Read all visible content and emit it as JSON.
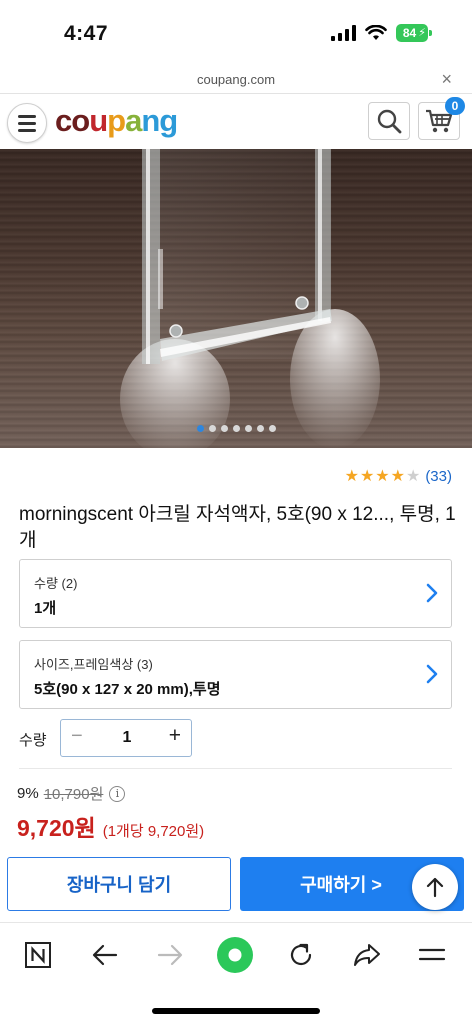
{
  "status_bar": {
    "time": "4:47",
    "battery": "84"
  },
  "browser": {
    "url": "coupang.com",
    "close_symbol": "×"
  },
  "header": {
    "logo_parts": [
      "co",
      "u",
      "p",
      "a",
      "ng"
    ],
    "cart_count": "0"
  },
  "gallery": {
    "total_images": 7,
    "active_index": 0
  },
  "rating": {
    "stars": 4,
    "max_stars": 5,
    "review_count": "(33)"
  },
  "product": {
    "title": "morningscent 아크릴 자석액자, 5호(90 x 12..., 투명, 1개"
  },
  "options": [
    {
      "label": "수량 (2)",
      "value": "1개"
    },
    {
      "label": "사이즈,프레임색상 (3)",
      "value": "5호(90 x 127 x 20 mm),투명"
    }
  ],
  "quantity": {
    "label": "수량",
    "minus": "−",
    "value": "1",
    "plus": "+"
  },
  "pricing": {
    "discount_rate": "9%",
    "original_price": "10,790원",
    "info_symbol": "i",
    "price": "9,720원",
    "unit_price": "(1개당 9,720원)"
  },
  "actions": {
    "add_to_cart": "장바구니 담기",
    "buy_now": "구매하기 >"
  },
  "colors": {
    "accent_blue": "#1e7ff0",
    "price_red": "#c8211d",
    "star_gold": "#f5a623",
    "green_button": "#2bc85a"
  },
  "toolbar_icons": [
    "naver-n-icon",
    "back-arrow-icon",
    "forward-arrow-icon",
    "green-home-icon",
    "reload-icon",
    "share-icon",
    "menu-icon"
  ]
}
